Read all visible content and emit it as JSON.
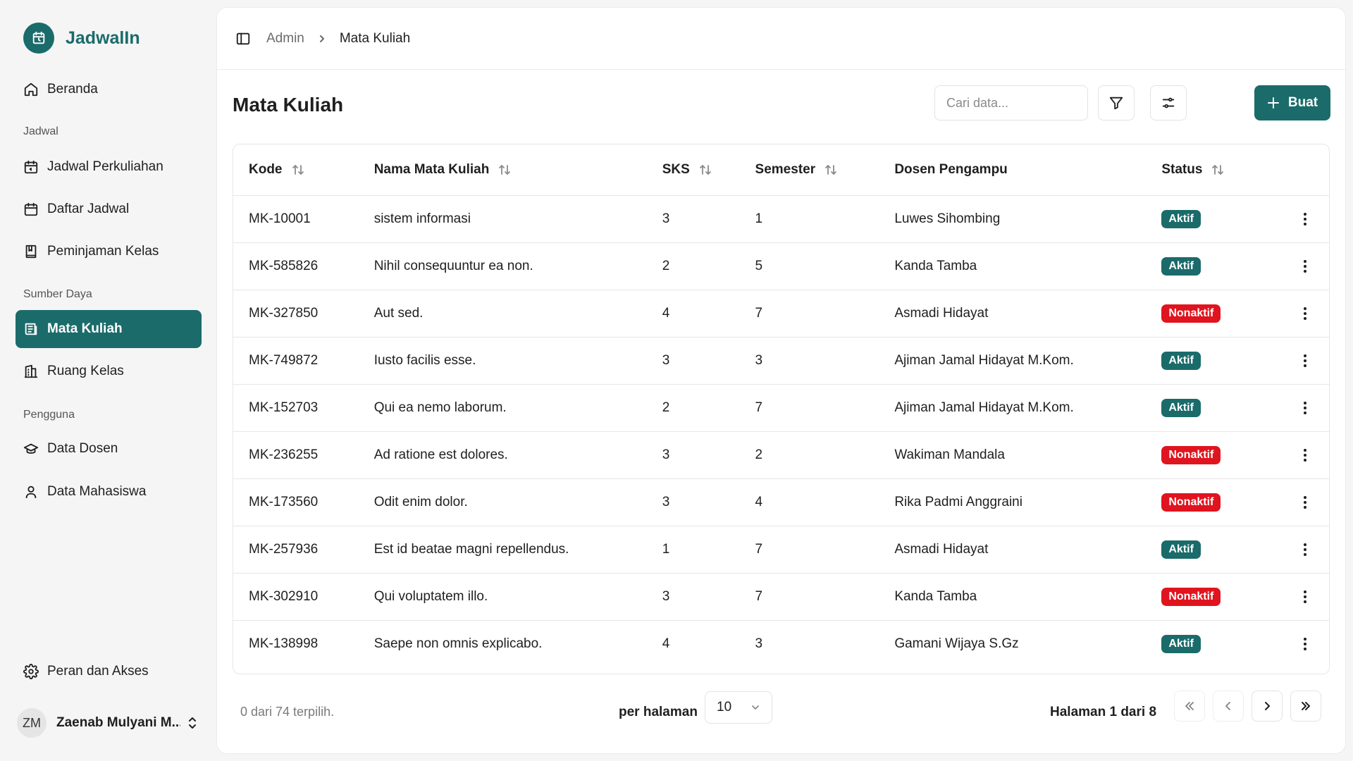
{
  "app": {
    "name": "JadwalIn"
  },
  "sidebar": {
    "home": {
      "label": "Beranda",
      "icon": "home-icon"
    },
    "sections": [
      {
        "label": "Jadwal"
      },
      {
        "label": "Sumber Daya"
      },
      {
        "label": "Pengguna"
      }
    ],
    "items": [
      {
        "label": "Jadwal Perkuliahan",
        "icon": "calendar-icon"
      },
      {
        "label": "Daftar Jadwal",
        "icon": "calendar-list-icon"
      },
      {
        "label": "Peminjaman Kelas",
        "icon": "book-icon"
      },
      {
        "label": "Mata Kuliah",
        "icon": "course-icon",
        "active": true
      },
      {
        "label": "Ruang Kelas",
        "icon": "building-icon"
      },
      {
        "label": "Data Dosen",
        "icon": "graduation-cap-icon"
      },
      {
        "label": "Data Mahasiswa",
        "icon": "user-icon"
      }
    ],
    "settings": {
      "label": "Peran dan Akses",
      "icon": "gear-icon"
    },
    "user": {
      "initials": "ZM",
      "name": "Zaenab Mulyani M..."
    }
  },
  "breadcrumb": {
    "root": "Admin",
    "current": "Mata Kuliah"
  },
  "page": {
    "title": "Mata Kuliah"
  },
  "toolbar": {
    "search_placeholder": "Cari data...",
    "create_label": "Buat"
  },
  "table": {
    "columns": [
      "Kode",
      "Nama Mata Kuliah",
      "SKS",
      "Semester",
      "Dosen Pengampu",
      "Status"
    ],
    "rows": [
      {
        "kode": "MK-10001",
        "nama": "sistem informasi",
        "sks": "3",
        "semester": "1",
        "dosen": "Luwes Sihombing",
        "status": "Aktif"
      },
      {
        "kode": "MK-585826",
        "nama": "Nihil consequuntur ea non.",
        "sks": "2",
        "semester": "5",
        "dosen": "Kanda Tamba",
        "status": "Aktif"
      },
      {
        "kode": "MK-327850",
        "nama": "Aut sed.",
        "sks": "4",
        "semester": "7",
        "dosen": "Asmadi Hidayat",
        "status": "Nonaktif"
      },
      {
        "kode": "MK-749872",
        "nama": "Iusto facilis esse.",
        "sks": "3",
        "semester": "3",
        "dosen": "Ajiman Jamal Hidayat M.Kom.",
        "status": "Aktif"
      },
      {
        "kode": "MK-152703",
        "nama": "Qui ea nemo laborum.",
        "sks": "2",
        "semester": "7",
        "dosen": "Ajiman Jamal Hidayat M.Kom.",
        "status": "Aktif"
      },
      {
        "kode": "MK-236255",
        "nama": "Ad ratione est dolores.",
        "sks": "3",
        "semester": "2",
        "dosen": "Wakiman Mandala",
        "status": "Nonaktif"
      },
      {
        "kode": "MK-173560",
        "nama": "Odit enim dolor.",
        "sks": "3",
        "semester": "4",
        "dosen": "Rika Padmi Anggraini",
        "status": "Nonaktif"
      },
      {
        "kode": "MK-257936",
        "nama": "Est id beatae magni repellendus.",
        "sks": "1",
        "semester": "7",
        "dosen": "Asmadi Hidayat",
        "status": "Aktif"
      },
      {
        "kode": "MK-302910",
        "nama": "Qui voluptatem illo.",
        "sks": "3",
        "semester": "7",
        "dosen": "Kanda Tamba",
        "status": "Nonaktif"
      },
      {
        "kode": "MK-138998",
        "nama": "Saepe non omnis explicabo.",
        "sks": "4",
        "semester": "3",
        "dosen": "Gamani Wijaya S.Gz",
        "status": "Aktif"
      }
    ]
  },
  "footer": {
    "selected_text": "0 dari 74 terpilih.",
    "per_page_label": "per halaman",
    "per_page_value": "10",
    "page_info": "Halaman 1 dari 8"
  },
  "colors": {
    "brand": "#1b6b6b",
    "danger": "#e0141e"
  }
}
